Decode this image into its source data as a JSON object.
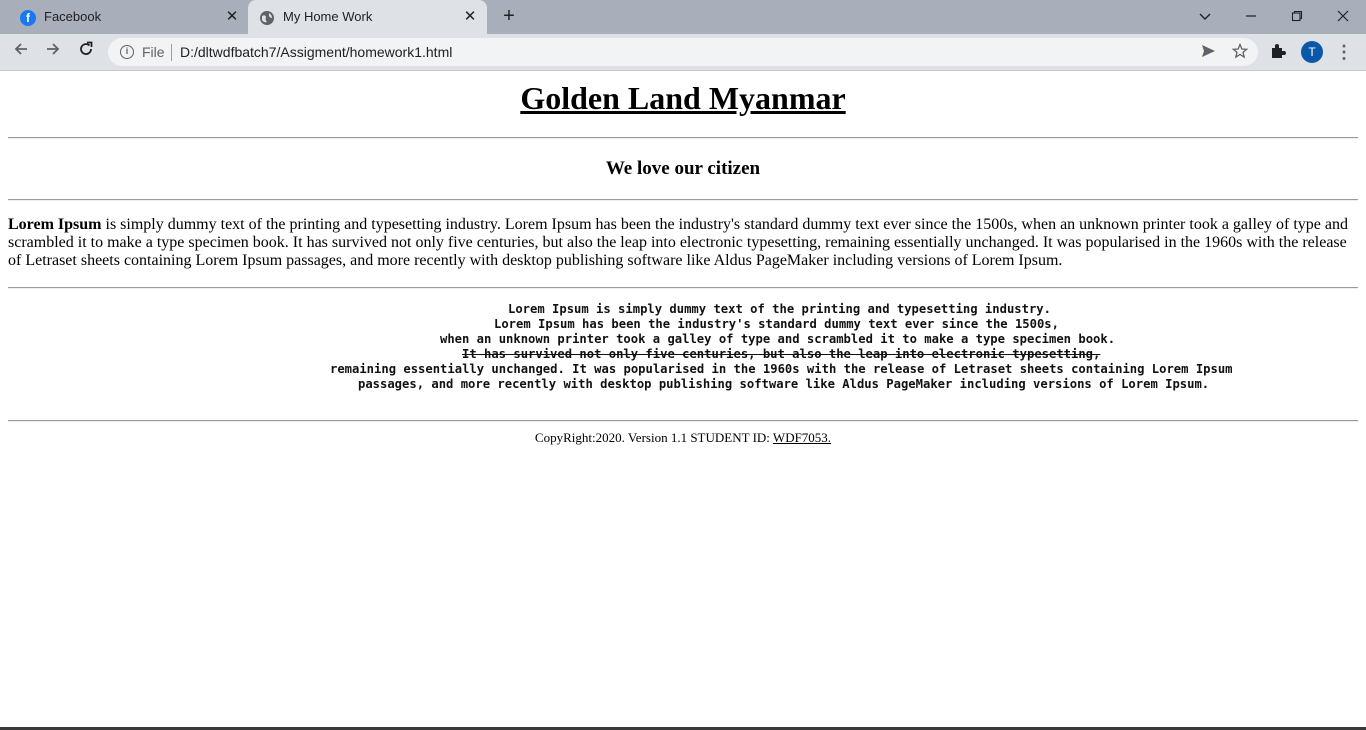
{
  "browser": {
    "tabs": [
      {
        "label": "Facebook",
        "favicon": "facebook-icon",
        "active": false
      },
      {
        "label": "My Home Work",
        "favicon": "globe-icon",
        "active": true
      }
    ],
    "close_glyph": "✕",
    "new_tab_glyph": "+",
    "address": {
      "scheme_label": "File",
      "url": "D:/dltwdfbatch7/Assigment/homework1.html"
    },
    "profile_initial": "T"
  },
  "page": {
    "title": "Golden Land Myanmar",
    "subtitle": "We love our citizen",
    "paragraph": {
      "bold_lead": "Lorem Ipsum",
      "text": " is simply dummy text of the printing and typesetting industry. Lorem Ipsum has been the industry's standard dummy text ever since the 1500s, when an unknown printer took a galley of type and scrambled it to make a type specimen book. It has survived not only five centuries, but also the leap into electronic typesetting, remaining essentially unchanged. It was popularised in the 1960s with the release of Letraset sheets containing Lorem Ipsum passages, and more recently with desktop publishing software like Aldus PageMaker including versions of Lorem Ipsum."
    },
    "preformatted": [
      "Lorem Ipsum is simply dummy text of the printing and typesetting industry.",
      "Lorem Ipsum has been the industry's standard dummy text ever since the 1500s,",
      "when an unknown printer took a galley of type and scrambled it to make a type specimen book.",
      "It has survived not only five centuries, but also the leap into electronic typesetting,",
      "remaining essentially unchanged. It was popularised in the 1960s with the release of Letraset sheets containing Lorem Ipsum",
      "passages, and more recently with desktop publishing software like Aldus PageMaker including versions of Lorem Ipsum."
    ],
    "footer": {
      "text": "CopyRight:2020. Version 1.1 STUDENT ID: ",
      "link": "WDF7053."
    }
  }
}
